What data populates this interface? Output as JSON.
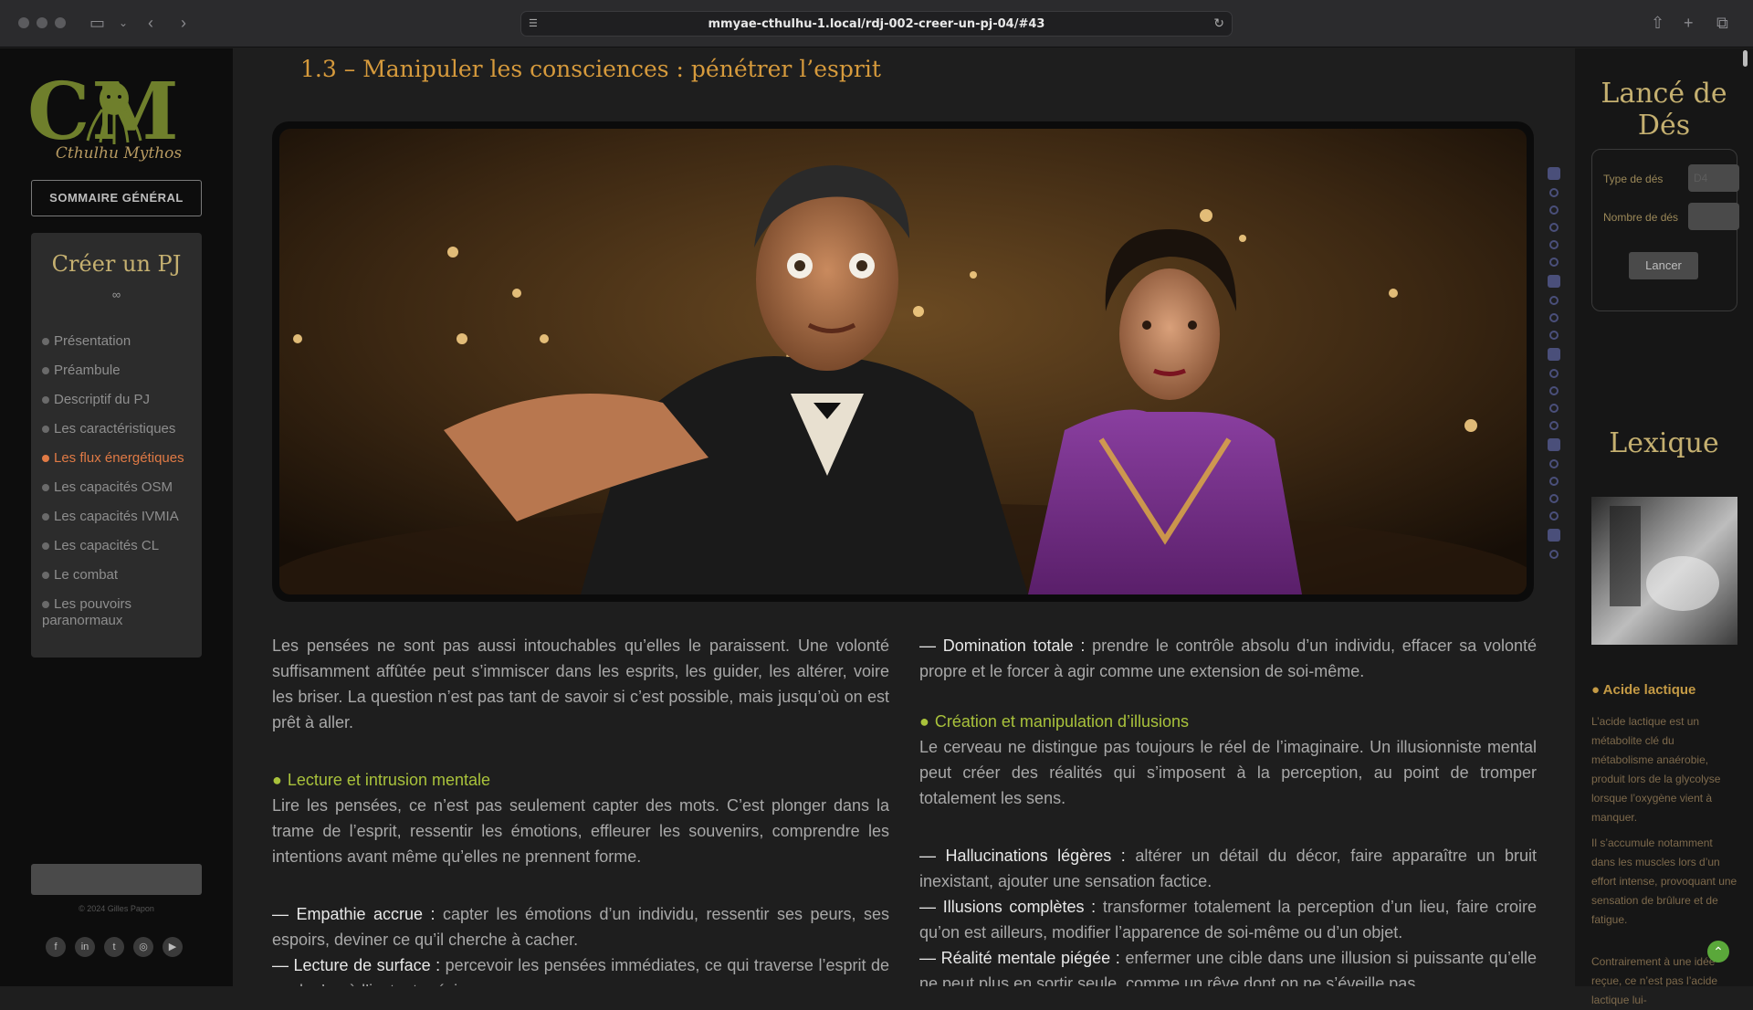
{
  "browser": {
    "url": "mmyae-cthulhu-1.local/rdj-002-creer-un-pj-04/#43"
  },
  "sidebar": {
    "logo_letters": "CM",
    "logo_subtitle": "Cthulhu Mythos",
    "summary_button": "SOMMAIRE GÉNÉRAL",
    "nav_title": "Créer un PJ",
    "nav_ornament": "∞",
    "nav_items": [
      {
        "label": "Présentation",
        "active": false
      },
      {
        "label": "Préambule",
        "active": false
      },
      {
        "label": "Descriptif du PJ",
        "active": false
      },
      {
        "label": "Les caractéristiques",
        "active": false
      },
      {
        "label": "Les flux énergétiques",
        "active": true
      },
      {
        "label": "Les capacités OSM",
        "active": false
      },
      {
        "label": "Les capacités IVMIA",
        "active": false
      },
      {
        "label": "Les capacités CL",
        "active": false
      },
      {
        "label": "Le combat",
        "active": false
      },
      {
        "label": "Les pouvoirs paranormaux",
        "active": false
      }
    ],
    "copyright": "© 2024 Gilles Papon",
    "socials": [
      "facebook-icon",
      "linkedin-icon",
      "twitter-icon",
      "instagram-icon",
      "youtube-icon"
    ]
  },
  "main": {
    "section_title": "1.3 – Manipuler les consciences : pénétrer l’esprit",
    "left": {
      "intro": "Les pensées ne sont pas aussi intouchables qu’elles le paraissent. Une volonté suffisamment affûtée peut s’immiscer dans les esprits, les guider, les altérer, voire les briser. La question n’est pas tant de savoir si c’est possible, mais jusqu’où on est prêt à aller.",
      "heading": "Lecture et intrusion mentale",
      "heading_text": "Lire les pensées, ce n’est pas seulement capter des mots. C’est plonger dans la trame de l’esprit, ressentir les émotions, effleurer les souvenirs, comprendre les intentions avant même qu’elles ne prennent forme.",
      "items": [
        {
          "term": "— Empathie accrue :",
          "text": " capter les émotions d’un individu, ressentir ses peurs, ses espoirs, deviner ce qu’il cherche à cacher."
        },
        {
          "term": "— Lecture de surface :",
          "text": " percevoir les pensées immédiates, ce qui traverse l’esprit de quelqu’un à l’instant précis."
        }
      ]
    },
    "right": {
      "intro_term": "— Domination totale :",
      "intro_text": " prendre le contrôle absolu d’un individu, effacer sa volonté propre et le forcer à agir comme une extension de soi-même.",
      "heading": "Création et manipulation d’illusions",
      "heading_text": "Le cerveau ne distingue pas toujours le réel de l’imaginaire. Un illusionniste mental peut créer des réalités qui s’imposent à la perception, au point de tromper totalement les sens.",
      "items": [
        {
          "term": "— Hallucinations légères :",
          "text": " altérer un détail du décor, faire apparaître un bruit inexistant, ajouter une sensation factice."
        },
        {
          "term": "— Illusions complètes :",
          "text": " transformer totalement la perception d’un lieu, faire croire qu’on est ailleurs, modifier l’apparence de soi-même ou d’un objet."
        },
        {
          "term": "— Réalité mentale piégée :",
          "text": " enfermer une cible dans une illusion si puissante qu’elle ne peut plus en sortir seule, comme un rêve dont on ne s’éveille pas."
        }
      ]
    }
  },
  "right_sidebar": {
    "dice_title": "Lancé de Dés",
    "dice_type_label": "Type de dés",
    "dice_type_value": "D4",
    "dice_count_label": "Nombre de dés",
    "dice_count_value": "",
    "roll_button": "Lancer",
    "lexicon_title": "Lexique",
    "lexicon_term": "Acide lactique",
    "lexicon_p1": "L’acide lactique est un métabolite clé du métabolisme anaérobie, produit lors de la glycolyse lorsque l’oxygène vient à manquer.",
    "lexicon_p2": "Il s’accumule notamment dans les muscles lors d’un effort intense, provoquant une sensation de brûlure et de fatigue.",
    "lexicon_p3": "Contrairement à une idée reçue, ce n’est pas l’acide lactique lui-"
  },
  "colors": {
    "accent_green": "#a9c23b",
    "title_gold": "#c5b070",
    "active_orange": "#e07a45",
    "section_orange": "#d69a3c"
  }
}
